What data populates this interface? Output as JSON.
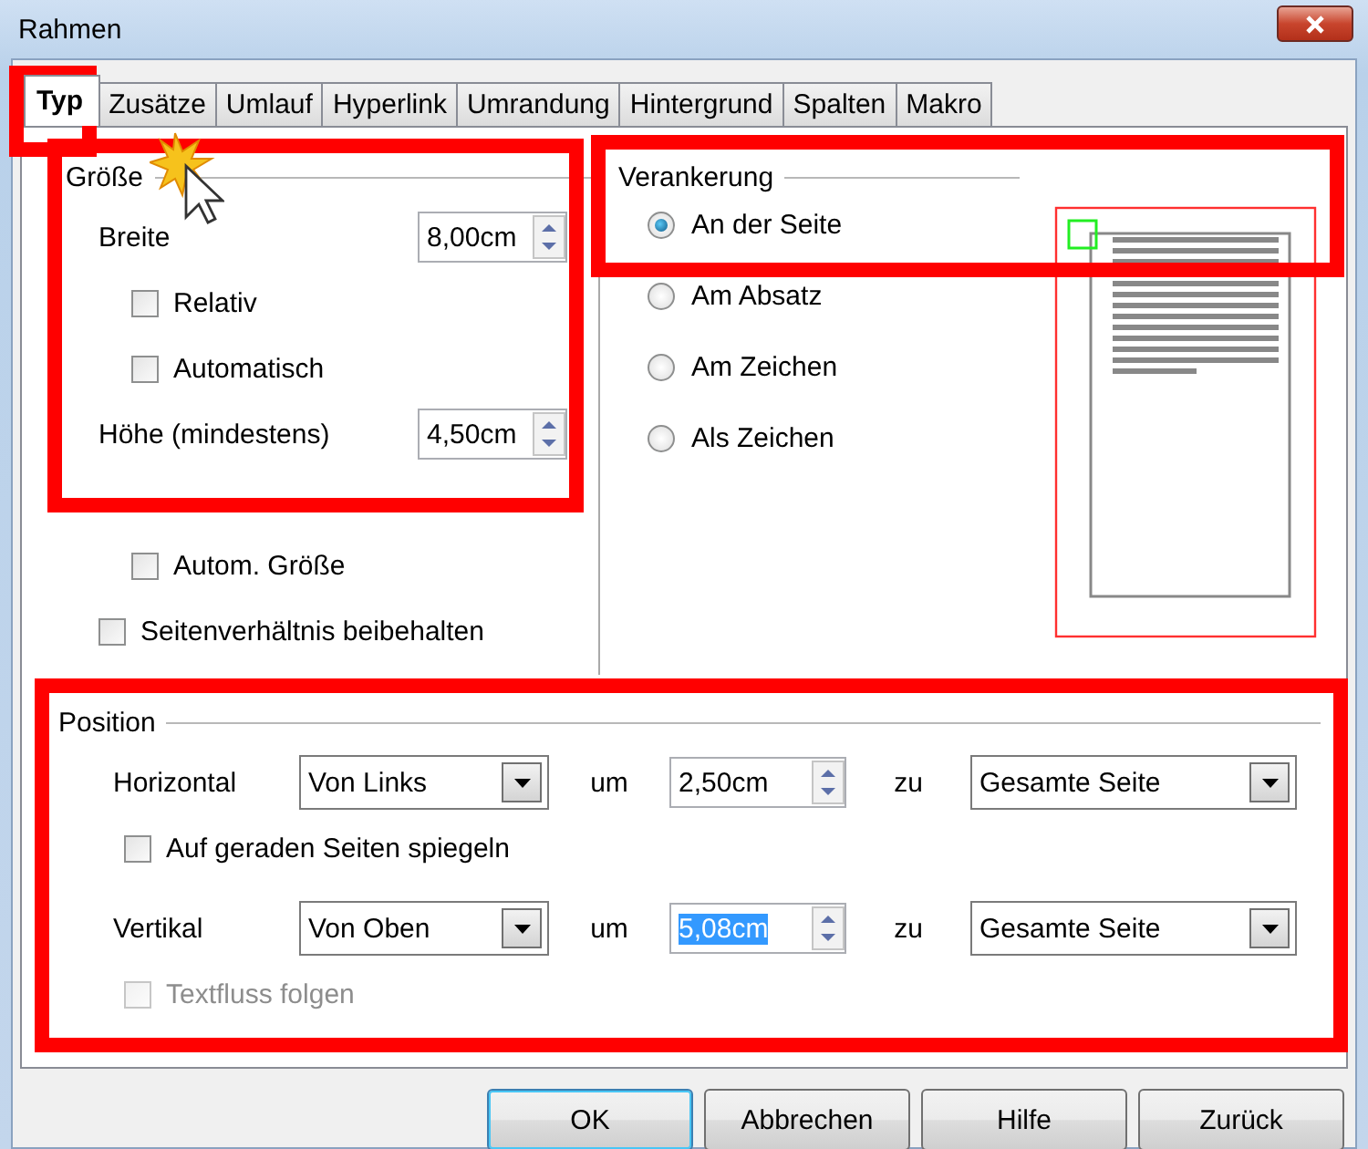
{
  "window": {
    "title": "Rahmen"
  },
  "tabs": [
    {
      "label": "Typ",
      "selected": true
    },
    {
      "label": "Zusätze",
      "selected": false
    },
    {
      "label": "Umlauf",
      "selected": false
    },
    {
      "label": "Hyperlink",
      "selected": false
    },
    {
      "label": "Umrandung",
      "selected": false
    },
    {
      "label": "Hintergrund",
      "selected": false
    },
    {
      "label": "Spalten",
      "selected": false
    },
    {
      "label": "Makro",
      "selected": false
    }
  ],
  "size": {
    "title": "Größe",
    "fields": [
      {
        "label": "Breite",
        "value": "8,00cm",
        "options": [
          {
            "label": "Relativ",
            "checked": false
          },
          {
            "label": "Automatisch",
            "checked": false
          }
        ]
      },
      {
        "label": "Höhe (mindestens)",
        "value": "4,50cm",
        "options": [
          {
            "label": "Autom. Größe",
            "checked": false
          }
        ]
      }
    ],
    "keep_ratio": {
      "label": "Seitenverhältnis beibehalten",
      "checked": false
    }
  },
  "anchor": {
    "title": "Verankerung",
    "options": [
      {
        "label": "An der Seite",
        "selected": true
      },
      {
        "label": "Am Absatz",
        "selected": false
      },
      {
        "label": "Am Zeichen",
        "selected": false
      },
      {
        "label": "Als Zeichen",
        "selected": false
      }
    ]
  },
  "position": {
    "title": "Position",
    "rows": [
      {
        "label": "Horizontal",
        "mode": "Von Links",
        "by_label": "um",
        "offset": "2,50cm",
        "offset_selected": false,
        "to_label": "zu",
        "reference": "Gesamte Seite",
        "option": {
          "label": "Auf geraden Seiten spiegeln",
          "checked": false,
          "disabled": false
        }
      },
      {
        "label": "Vertikal",
        "mode": "Von Oben",
        "by_label": "um",
        "offset": "5,08cm",
        "offset_selected": true,
        "to_label": "zu",
        "reference": "Gesamte Seite",
        "option": {
          "label": "Textfluss folgen",
          "checked": false,
          "disabled": true
        }
      }
    ]
  },
  "buttons": [
    {
      "label": "OK",
      "default": true
    },
    {
      "label": "Abbrechen",
      "default": false
    },
    {
      "label": "Hilfe",
      "default": false
    },
    {
      "label": "Zurück",
      "default": false
    }
  ]
}
